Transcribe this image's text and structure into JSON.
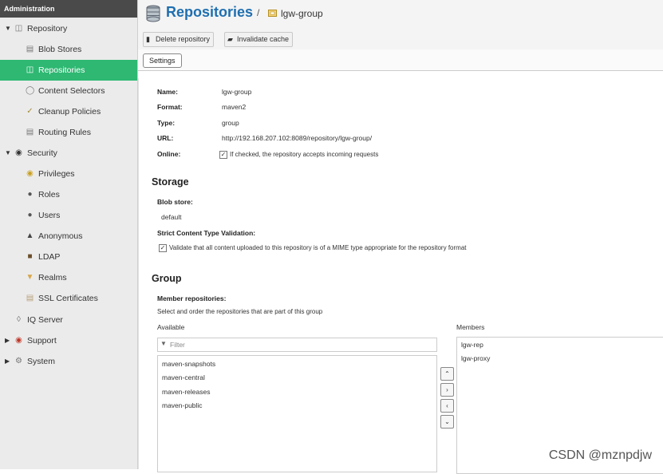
{
  "sidebar": {
    "header": "Administration",
    "items": [
      {
        "label": "Repository",
        "icon": "database-icon"
      },
      {
        "label": "Blob Stores",
        "icon": "hard-drive-icon"
      },
      {
        "label": "Repositories",
        "icon": "database-icon"
      },
      {
        "label": "Content Selectors",
        "icon": "selector-icon"
      },
      {
        "label": "Cleanup Policies",
        "icon": "broom-icon"
      },
      {
        "label": "Routing Rules",
        "icon": "route-icon"
      },
      {
        "label": "Security",
        "icon": "eye-icon"
      },
      {
        "label": "Privileges",
        "icon": "medal-icon"
      },
      {
        "label": "Roles",
        "icon": "user-badge-icon"
      },
      {
        "label": "Users",
        "icon": "users-icon"
      },
      {
        "label": "Anonymous",
        "icon": "anonymous-user-icon"
      },
      {
        "label": "LDAP",
        "icon": "book-icon"
      },
      {
        "label": "Realms",
        "icon": "shield-icon"
      },
      {
        "label": "SSL Certificates",
        "icon": "certificate-icon"
      },
      {
        "label": "IQ Server",
        "icon": "iq-server-icon"
      },
      {
        "label": "Support",
        "icon": "lifebuoy-icon"
      },
      {
        "label": "System",
        "icon": "gear-icon"
      }
    ]
  },
  "header": {
    "title": "Repositories",
    "separator": "/",
    "crumb": "lgw-group",
    "delete_label": "Delete repository",
    "invalidate_label": "Invalidate cache"
  },
  "tabs": {
    "settings": "Settings"
  },
  "details": {
    "name_label": "Name:",
    "name_value": "lgw-group",
    "format_label": "Format:",
    "format_value": "maven2",
    "type_label": "Type:",
    "type_value": "group",
    "url_label": "URL:",
    "url_value": "http://192.168.207.102:8089/repository/lgw-group/",
    "online_label": "Online:",
    "online_text": "If checked, the repository accepts incoming requests"
  },
  "storage": {
    "heading": "Storage",
    "blob_label": "Blob store:",
    "blob_value": "default",
    "strict_label": "Strict Content Type Validation:",
    "strict_text": "Validate that all content uploaded to this repository is of a MIME type appropriate for the repository format"
  },
  "group": {
    "heading": "Group",
    "members_label": "Member repositories:",
    "members_help": "Select and order the repositories that are part of this group",
    "available_label": "Available",
    "members_col_label": "Members",
    "filter_placeholder": "Filter",
    "available": [
      "maven-snapshots",
      "maven-central",
      "maven-releases",
      "maven-public"
    ],
    "members": [
      "lgw-rep",
      "lgw-proxy"
    ],
    "move_buttons": [
      "^",
      ">",
      "<",
      "v"
    ]
  },
  "watermark": "CSDN @mznpdjw",
  "colors": {
    "accent": "#2eb872",
    "title": "#1f6fb0",
    "sidebar_header": "#4a4a4a"
  }
}
